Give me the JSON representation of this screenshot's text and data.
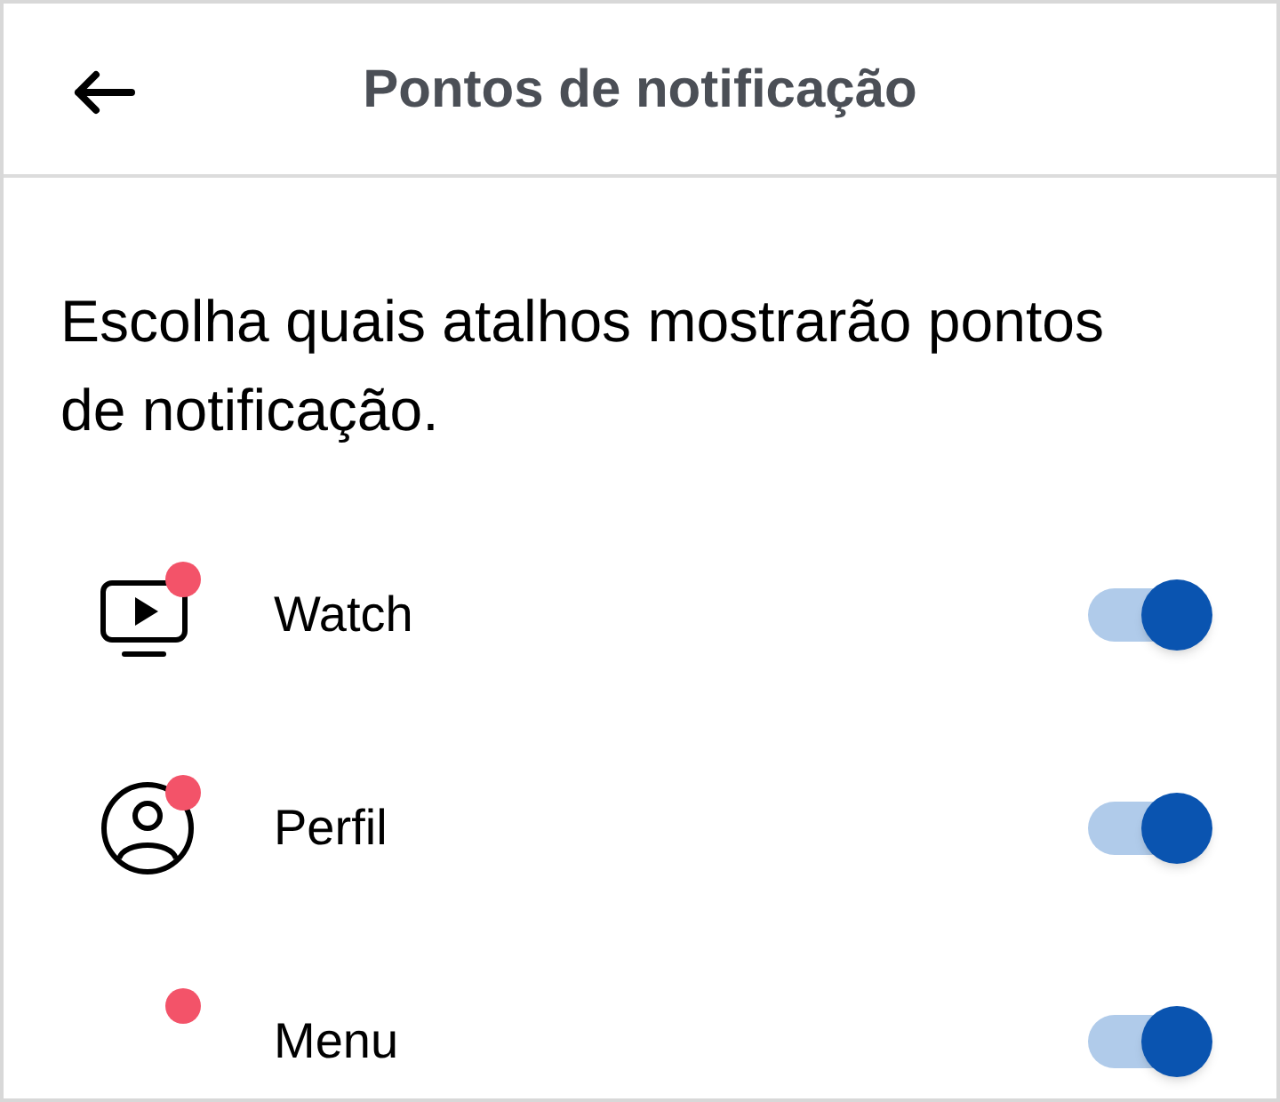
{
  "header": {
    "title": "Pontos de notificação"
  },
  "description": "Escolha quais atalhos mostrarão pontos de notificação.",
  "items": [
    {
      "kind": "video",
      "label": "Watch",
      "dot": true,
      "on": true
    },
    {
      "kind": "profile",
      "label": "Perfil",
      "dot": true,
      "on": true
    },
    {
      "kind": "blank",
      "label": "Menu",
      "dot": true,
      "on": true
    }
  ]
}
